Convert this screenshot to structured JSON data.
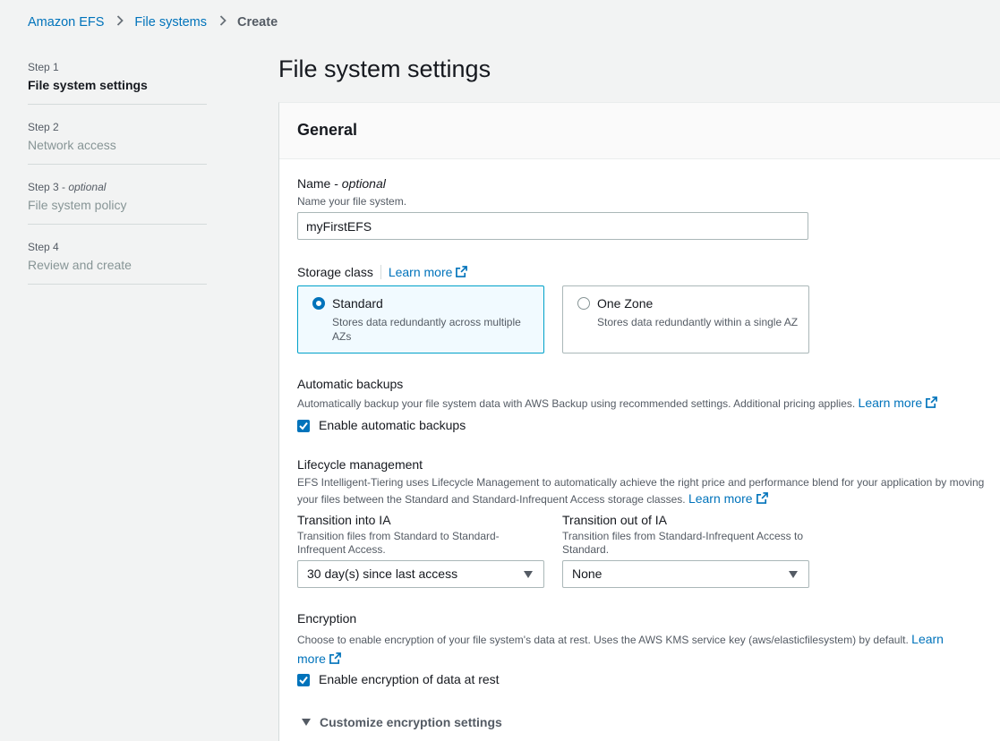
{
  "breadcrumb": {
    "items": [
      "Amazon EFS",
      "File systems"
    ],
    "current": "Create"
  },
  "steps": [
    {
      "num": "Step 1",
      "title": "File system settings"
    },
    {
      "num": "Step 2",
      "title": "Network access"
    },
    {
      "num": "Step 3",
      "optional": "optional",
      "title": "File system policy"
    },
    {
      "num": "Step 4",
      "title": "Review and create"
    }
  ],
  "page_title": "File system settings",
  "general": {
    "heading": "General",
    "name": {
      "label": "Name -",
      "optional": "optional",
      "description": "Name your file system.",
      "value": "myFirstEFS"
    },
    "storage_class": {
      "label": "Storage class",
      "learn_more": "Learn more",
      "options": [
        {
          "title": "Standard",
          "desc": "Stores data redundantly across multiple AZs",
          "selected": true
        },
        {
          "title": "One Zone",
          "desc": "Stores data redundantly within a single AZ",
          "selected": false
        }
      ]
    },
    "backups": {
      "label": "Automatic backups",
      "description": "Automatically backup your file system data with AWS Backup using recommended settings. Additional pricing applies.",
      "learn_more": "Learn more",
      "checkbox_label": "Enable automatic backups",
      "checked": true
    },
    "lifecycle": {
      "label": "Lifecycle management",
      "description": "EFS Intelligent-Tiering uses Lifecycle Management to automatically achieve the right price and performance blend for your application by moving your files between the Standard and Standard-Infrequent Access storage classes.",
      "learn_more": "Learn more",
      "into_ia": {
        "label": "Transition into IA",
        "description": "Transition files from Standard to Standard-Infrequent Access.",
        "value": "30 day(s) since last access"
      },
      "out_of_ia": {
        "label": "Transition out of IA",
        "description": "Transition files from Standard-Infrequent Access to Standard.",
        "value": "None"
      }
    },
    "encryption": {
      "label": "Encryption",
      "description": "Choose to enable encryption of your file system's data at rest. Uses the AWS KMS service key (aws/elasticfilesystem) by default.",
      "learn_more_1": "Learn",
      "learn_more_2": "more",
      "checkbox_label": "Enable encryption of data at rest",
      "checked": true,
      "customize": "Customize encryption settings"
    }
  },
  "colors": {
    "link": "#0073bb",
    "selected_border": "#00a1c9",
    "selected_bg": "#f1faff"
  }
}
